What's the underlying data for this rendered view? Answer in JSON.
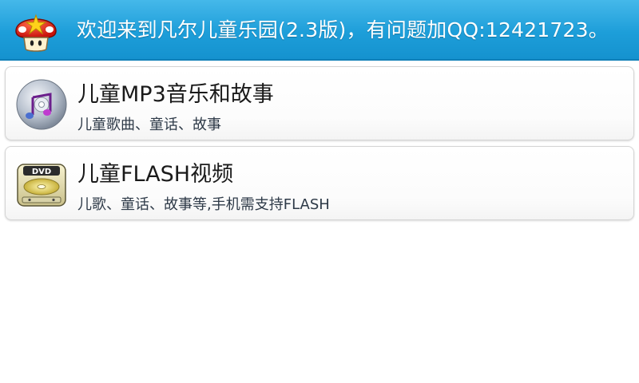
{
  "header": {
    "title": "欢迎来到凡尔儿童乐园(2.3版)，有问题加QQ:12421723。",
    "icon": "mushroom-star-icon"
  },
  "items": [
    {
      "title": "儿童MP3音乐和故事",
      "subtitle": "儿童歌曲、童话、故事",
      "icon": "music-cd-icon"
    },
    {
      "title": "儿童FLASH视频",
      "subtitle": "儿歌、童话、故事等,手机需支持FLASH",
      "icon": "dvd-player-icon"
    }
  ],
  "colors": {
    "header_bg": "#1d9ed9",
    "header_text": "#ffffff"
  }
}
